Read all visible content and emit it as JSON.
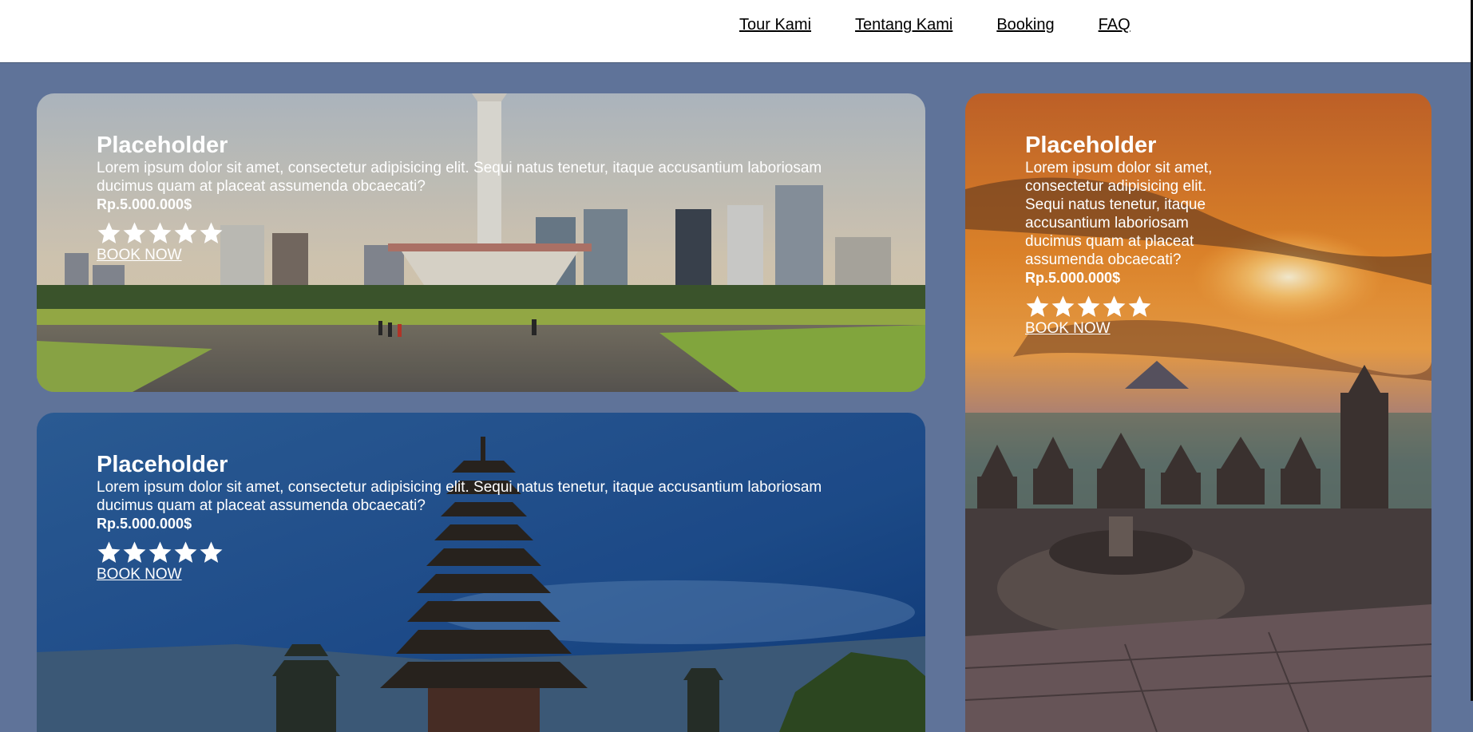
{
  "nav": {
    "items": [
      {
        "label": "Tour Kami"
      },
      {
        "label": "Tentang Kami"
      },
      {
        "label": "Booking"
      },
      {
        "label": "FAQ"
      }
    ]
  },
  "cards": [
    {
      "title": "Placeholder",
      "description": "Lorem ipsum dolor sit amet, consectetur adipisicing elit. Sequi natus tenetur, itaque accusantium laboriosam ducimus quam at placeat assumenda obcaecati?",
      "price": "Rp.5.000.000$",
      "rating": 5,
      "rating_max": 5,
      "cta": "BOOK NOW"
    },
    {
      "title": "Placeholder",
      "description": "Lorem ipsum dolor sit amet, consectetur adipisicing elit. Sequi natus tenetur, itaque accusantium laboriosam ducimus quam at placeat assumenda obcaecati?",
      "price": "Rp.5.000.000$",
      "rating": 5,
      "rating_max": 5,
      "cta": "BOOK NOW"
    },
    {
      "title": "Placeholder",
      "description": "Lorem ipsum dolor sit amet, consectetur adipisicing elit. Sequi natus tenetur, itaque accusantium laboriosam ducimus quam at placeat assumenda obcaecati?",
      "price": "Rp.5.000.000$",
      "rating": 5,
      "rating_max": 5,
      "cta": "BOOK NOW"
    }
  ],
  "colors": {
    "page_background": "#5f7399",
    "header_background": "#ffffff",
    "card_text": "#ffffff"
  }
}
